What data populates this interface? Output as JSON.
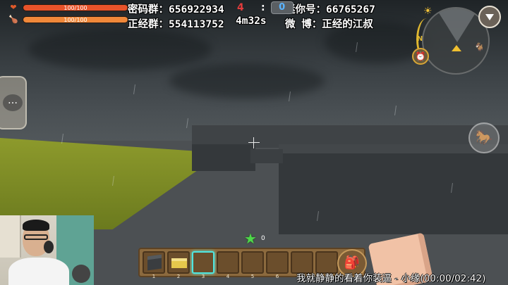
{
  "hud": {
    "health": {
      "label": "100/100",
      "fraction": 1.0,
      "color": "#e8532a",
      "icon": "heart-icon"
    },
    "hunger": {
      "label": "100/100",
      "fraction": 1.0,
      "color": "#f0883a",
      "icon": "drumstick-icon"
    }
  },
  "overlay": {
    "line1_left": "密码群：656922934",
    "line1_right": "迷你号：66765267",
    "line2_left": "正经群：554113752",
    "line2_right": "微  博：正经的江叔",
    "timer": "4m32s"
  },
  "scoreboard": {
    "red_score": "4",
    "separator": ":",
    "blue_score": "0"
  },
  "minimap": {
    "compass_label": "N",
    "sun_icon": "sun-icon",
    "clock_icon": "clock-icon",
    "pet_icon": "pet-icon"
  },
  "hotbar": {
    "slots": [
      {
        "num": "1",
        "item": "dark-block"
      },
      {
        "num": "2",
        "item": "sand-block"
      },
      {
        "num": "3",
        "item": ""
      },
      {
        "num": "4",
        "item": ""
      },
      {
        "num": "5",
        "item": ""
      },
      {
        "num": "6",
        "item": ""
      },
      {
        "num": "7",
        "item": ""
      },
      {
        "num": "8",
        "item": ""
      }
    ],
    "selected_index": 2,
    "star_count": "0"
  },
  "caption": "我就静静的看着你装逼 - 小缘(00:00/02:42)",
  "colors": {
    "accent_selected": "#4fe6e0",
    "hotbar_bg": "#8c6a3e",
    "score_blue": "#5ab4ff",
    "score_red": "#e23c3c"
  }
}
